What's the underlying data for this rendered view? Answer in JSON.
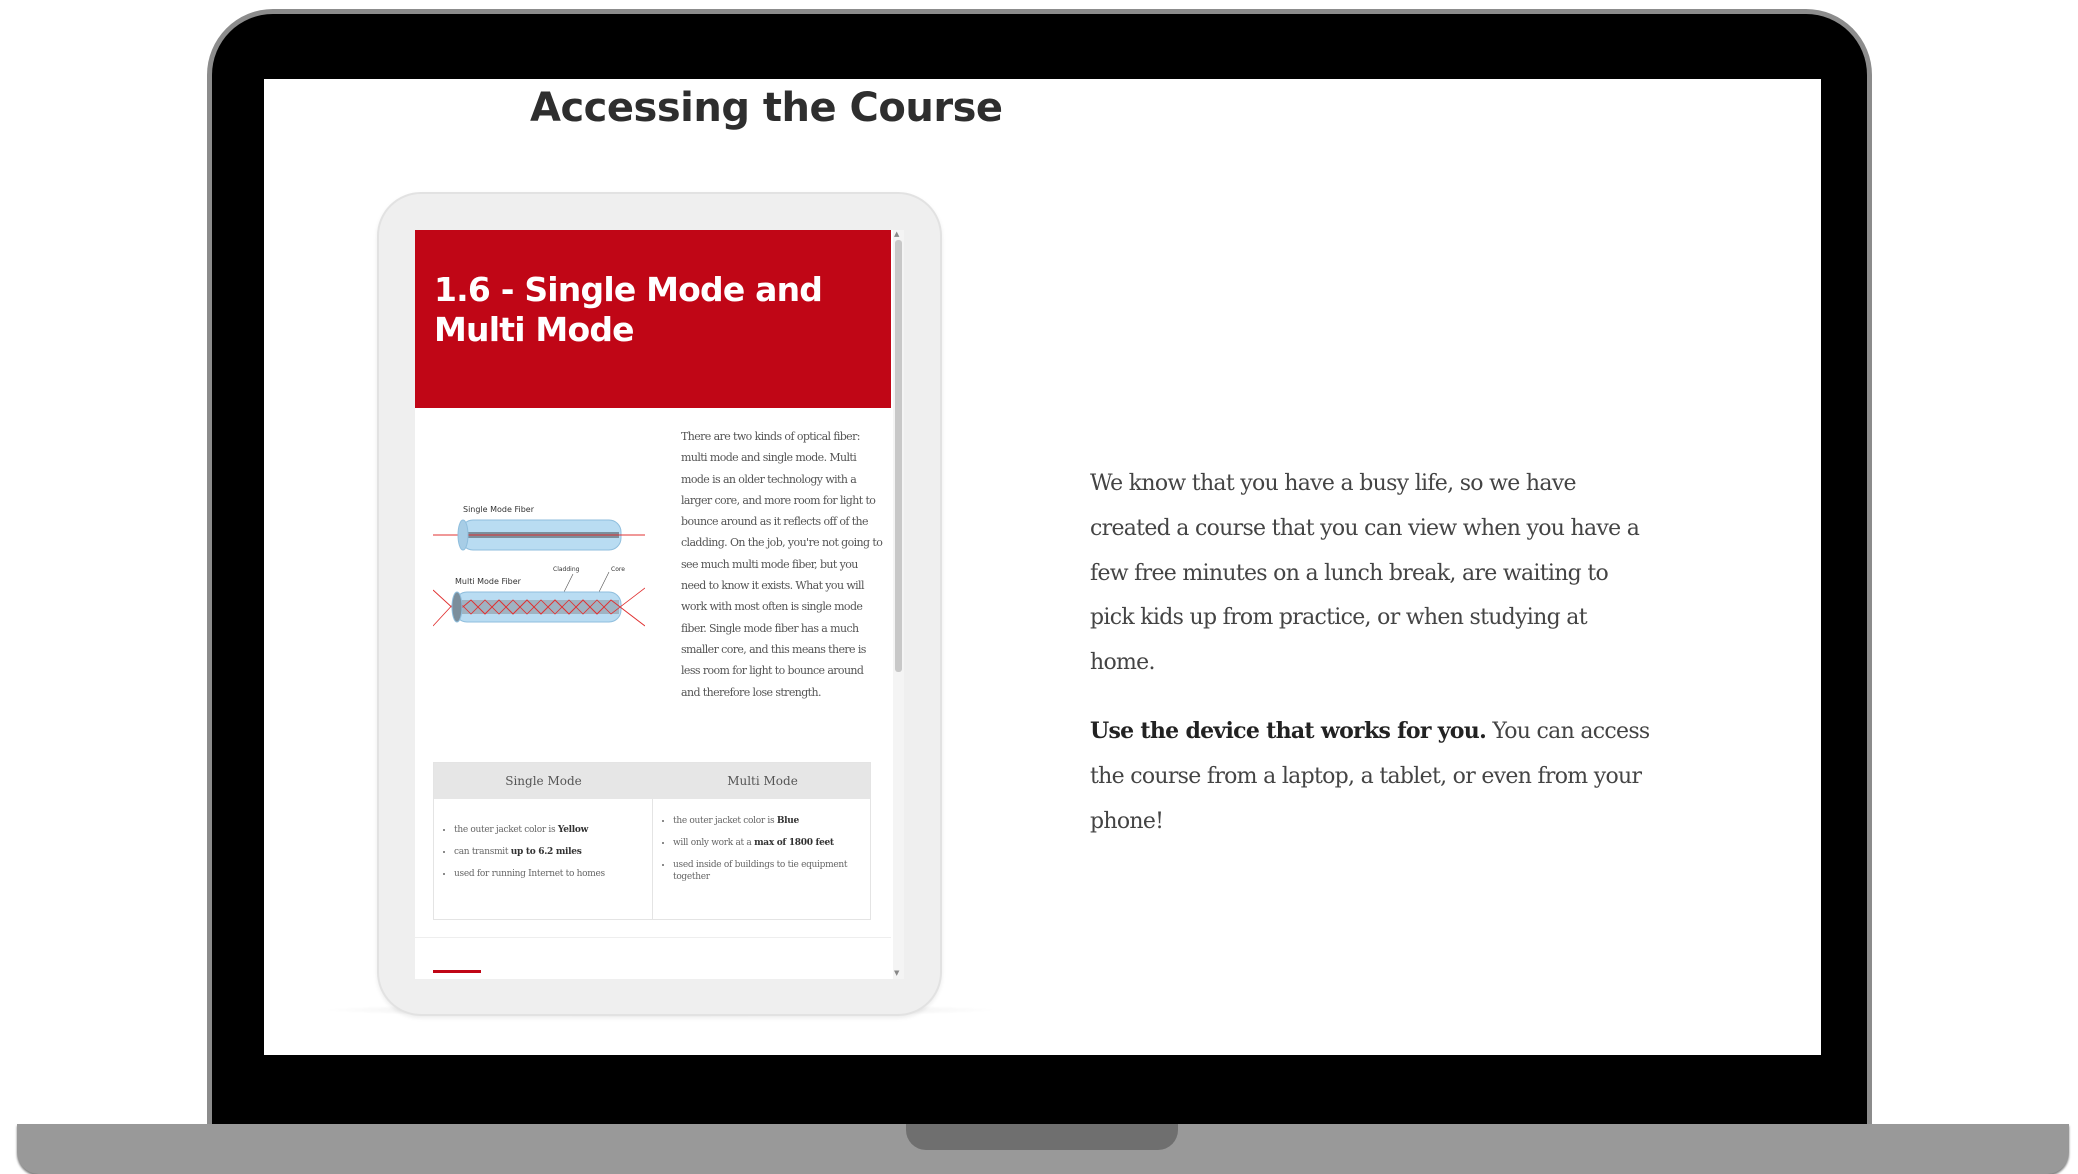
{
  "page": {
    "title": "Accessing the Course"
  },
  "lesson": {
    "title": "1.6 - Single Mode and Multi Mode",
    "accent_color": "#c00616",
    "body": "There are two kinds of optical fiber: multi mode and single mode. Multi mode is an older technology with a larger core, and more room for light to bounce around as it reflects off of the cladding. On the job, you're not going to see much multi mode fiber, but you need to know it exists. What you will work with most often is single mode fiber. Single mode fiber has a much smaller core, and this means there is less room for light to bounce around and therefore lose strength.",
    "diagram": {
      "single_label": "Single Mode Fiber",
      "multi_label": "Multi Mode Fiber",
      "cladding_label": "Cladding",
      "core_label": "Core"
    },
    "table": {
      "headers": [
        "Single Mode",
        "Multi Mode"
      ],
      "single_mode": [
        {
          "pre": "the outer jacket color is ",
          "bold": "Yellow",
          "post": ""
        },
        {
          "pre": "can transmit ",
          "bold": "up to 6.2 miles",
          "post": ""
        },
        {
          "pre": "used for running Internet to homes",
          "bold": "",
          "post": ""
        }
      ],
      "multi_mode": [
        {
          "pre": "the outer jacket color is ",
          "bold": "Blue",
          "post": ""
        },
        {
          "pre": "will only work at a ",
          "bold": "max of 1800 feet",
          "post": ""
        },
        {
          "pre": "used inside of buildings to tie equipment together",
          "bold": "",
          "post": ""
        }
      ]
    }
  },
  "copy": {
    "intro": "We know that you have a busy life, so we have created a course that you can view when you have a few free minutes on a lunch break, are waiting to pick kids up from practice, or when studying at home.",
    "access_bold": "Use the device that works for you.",
    "access_rest": " You can access the course from a laptop, a tablet, or even from your phone!"
  }
}
